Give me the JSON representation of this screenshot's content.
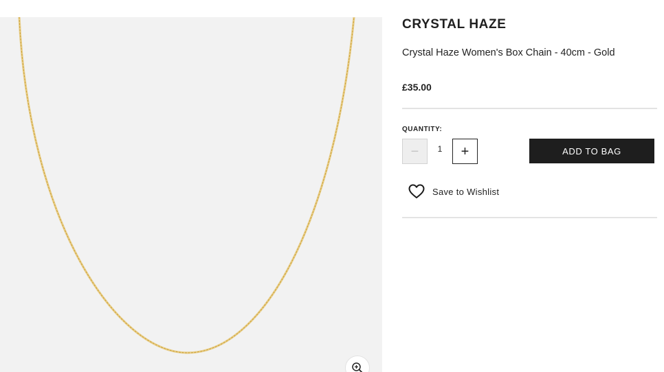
{
  "product": {
    "brand": "CRYSTAL HAZE",
    "name": "Crystal Haze Women's Box Chain - 40cm - Gold",
    "price": "£35.00"
  },
  "quantity": {
    "label": "QUANTITY:",
    "value": "1",
    "decrement_symbol": "−",
    "increment_symbol": "+"
  },
  "actions": {
    "add_to_bag": "ADD TO BAG",
    "wishlist": "Save to Wishlist"
  },
  "icons": {
    "zoom": "zoom-in-icon",
    "wishlist": "heart-icon"
  },
  "colors": {
    "image_background": "#f2f2f2",
    "button_dark": "#1e1e1e",
    "chain_gold": "#e3c16f"
  }
}
